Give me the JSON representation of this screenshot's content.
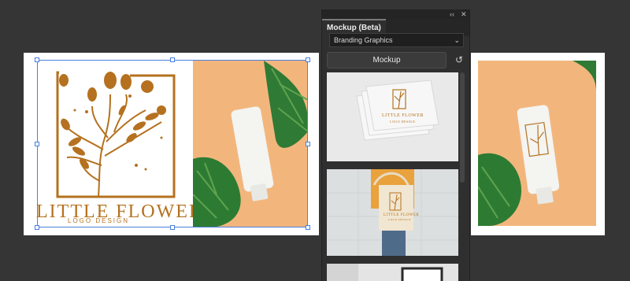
{
  "canvas": {
    "background": "#353535",
    "logo": {
      "title": "LITTLE FLOWER",
      "subtitle": "LOGO DESIGN",
      "color": "#b5711f"
    }
  },
  "panel": {
    "tab_label": "Mockup (Beta)",
    "collapse_icon": "double-chevron-icon",
    "close_icon": "close-icon",
    "category_select": {
      "selected": "Branding Graphics"
    },
    "mockup_button_label": "Mockup",
    "reset_icon": "reset-icon",
    "thumbnails": [
      {
        "name": "business-cards-mockup",
        "logo_title": "LITTLE FLOWER",
        "logo_subtitle": "LOGO DESIGN"
      },
      {
        "name": "tote-bag-mockup",
        "logo_title": "LITTLE FLOWER",
        "logo_subtitle": "LOGO DESIGN"
      },
      {
        "name": "frame-mockup"
      }
    ]
  }
}
